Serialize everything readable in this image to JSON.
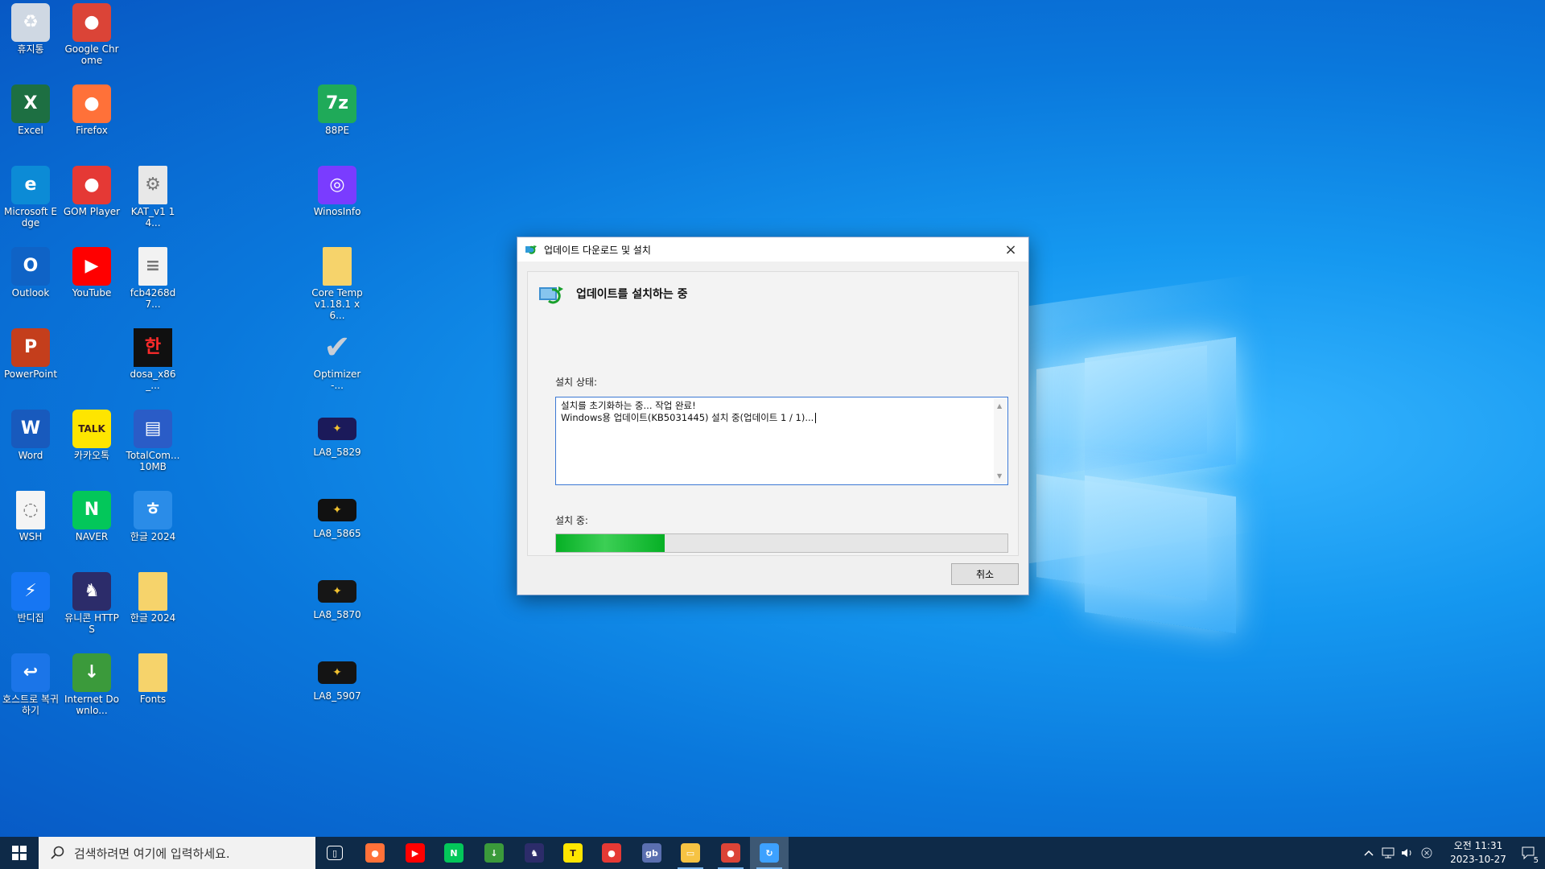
{
  "desktop": {
    "icons": [
      {
        "label": "휴지통",
        "icon": "recycle-bin-icon",
        "color": "#cfd8e3"
      },
      {
        "label": "Google Chrome",
        "icon": "chrome-icon",
        "color": "#db4437"
      },
      {
        "label": "Excel",
        "icon": "excel-icon",
        "color": "#1d6f42"
      },
      {
        "label": "Firefox",
        "icon": "firefox-icon",
        "color": "#ff7139"
      },
      {
        "label": "88PE",
        "icon": "88pe-icon",
        "color": "#1faa59"
      },
      {
        "label": "Microsoft Edge",
        "icon": "edge-icon",
        "color": "#0c8bd6"
      },
      {
        "label": "GOM Player",
        "icon": "gom-player-icon",
        "color": "#e53935"
      },
      {
        "label": "KAT_v1 14...",
        "icon": "settings-file-icon",
        "color": "#e8e8e8"
      },
      {
        "label": "WinosInfo",
        "icon": "winosinfo-icon",
        "color": "#7a3cff"
      },
      {
        "label": "Outlook",
        "icon": "outlook-icon",
        "color": "#0f63c6"
      },
      {
        "label": "YouTube",
        "icon": "youtube-icon",
        "color": "#ff0000"
      },
      {
        "label": "fcb4268d7...",
        "icon": "document-icon",
        "color": "#f2f2f2"
      },
      {
        "label": "Core Temp v1.18.1 x6...",
        "icon": "folder-icon",
        "color": "#f6d36b"
      },
      {
        "label": "PowerPoint",
        "icon": "powerpoint-icon",
        "color": "#c43e1c"
      },
      {
        "label": "dosa_x86_...",
        "icon": "dosa-icon",
        "color": "#101010"
      },
      {
        "label": "Optimizer-...",
        "icon": "checkmark-icon",
        "color": "#9aa5b1"
      },
      {
        "label": "Word",
        "icon": "word-icon",
        "color": "#185abd"
      },
      {
        "label": "카카오톡",
        "icon": "kakaotalk-icon",
        "color": "#fee500"
      },
      {
        "label": "TotalCom... 10MB",
        "icon": "floppy-icon",
        "color": "#2a5cc7"
      },
      {
        "label": "LA8_5829",
        "icon": "image-icon",
        "color": "#1b1a5a"
      },
      {
        "label": "WSH",
        "icon": "script-file-icon",
        "color": "#f4f4f4"
      },
      {
        "label": "NAVER",
        "icon": "naver-icon",
        "color": "#03c75a"
      },
      {
        "label": "한글 2024",
        "icon": "hangul-icon",
        "color": "#2a8ce8"
      },
      {
        "label": "LA8_5865",
        "icon": "image-icon",
        "color": "#111111"
      },
      {
        "label": "반디집",
        "icon": "bandizip-icon",
        "color": "#1676f3"
      },
      {
        "label": "유니콘 HTTPS",
        "icon": "unicorn-icon",
        "color": "#2c2c6a"
      },
      {
        "label": "한글 2024",
        "icon": "folder-icon",
        "color": "#f6d36b"
      },
      {
        "label": "LA8_5870",
        "icon": "image-icon",
        "color": "#161616"
      },
      {
        "label": "호스트로 복귀하기",
        "icon": "host-return-icon",
        "color": "#1b75e8"
      },
      {
        "label": "Internet Downlo...",
        "icon": "idm-icon",
        "color": "#3b9a3b"
      },
      {
        "label": "Fonts",
        "icon": "folder-icon",
        "color": "#f6d36b"
      },
      {
        "label": "LA8_5907",
        "icon": "image-icon",
        "color": "#141414"
      }
    ]
  },
  "dialog": {
    "title": "업데이트 다운로드 및 설치",
    "heading": "업데이트를 설치하는 중",
    "status_label": "설치 상태:",
    "status_lines": [
      "설치를 초기화하는 중... 작업 완료!",
      "Windows용 업데이트(KB5031445) 설치 중(업데이트 1 / 1)..."
    ],
    "progress_label": "설치 중:",
    "progress_fraction": 0.24,
    "progress_color": "#06b025",
    "cancel_label": "취소",
    "close_icon": "×"
  },
  "taskbar": {
    "search_placeholder": "검색하려면 여기에 입력하세요.",
    "apps": [
      {
        "icon": "task-view-icon",
        "color": "#0e2a48"
      },
      {
        "icon": "firefox-icon",
        "color": "#ff7139"
      },
      {
        "icon": "youtube-icon",
        "color": "#ff0000"
      },
      {
        "icon": "naver-icon",
        "color": "#03c75a"
      },
      {
        "icon": "idm-icon",
        "color": "#3b9a3b"
      },
      {
        "icon": "unicorn-icon",
        "color": "#2c2c6a"
      },
      {
        "icon": "kakaotalk-icon",
        "color": "#fee500"
      },
      {
        "icon": "gom-player-icon",
        "color": "#e53935"
      },
      {
        "icon": "gb-icon",
        "color": "#5a6fb0"
      },
      {
        "icon": "file-explorer-icon",
        "color": "#f6c343"
      },
      {
        "icon": "chrome-icon",
        "color": "#db4437"
      },
      {
        "icon": "windows-update-icon",
        "color": "#3da1ff"
      }
    ],
    "clock_time": "오전 11:31",
    "clock_date": "2023-10-27",
    "notification_count": "5"
  }
}
